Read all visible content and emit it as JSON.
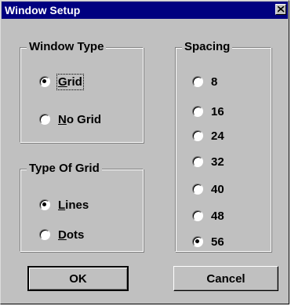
{
  "window": {
    "title": "Window Setup",
    "close_icon": "close-icon"
  },
  "window_type": {
    "label": "Window Type",
    "options": [
      {
        "label": "Grid",
        "mnemonic": "G",
        "rest": "rid",
        "selected": true
      },
      {
        "label": "No Grid",
        "mnemonic": "N",
        "rest": "o Grid",
        "selected": false
      }
    ]
  },
  "grid_type": {
    "label": "Type Of Grid",
    "options": [
      {
        "label": "Lines",
        "mnemonic": "L",
        "rest": "ines",
        "selected": true
      },
      {
        "label": "Dots",
        "mnemonic": "D",
        "rest": "ots",
        "selected": false
      }
    ]
  },
  "spacing": {
    "label": "Spacing",
    "options": [
      {
        "label": "8",
        "selected": false
      },
      {
        "label": "16",
        "selected": false
      },
      {
        "label": "24",
        "selected": false
      },
      {
        "label": "32",
        "selected": false
      },
      {
        "label": "40",
        "selected": false
      },
      {
        "label": "48",
        "selected": false
      },
      {
        "label": "56",
        "selected": true
      }
    ]
  },
  "buttons": {
    "ok": "OK",
    "cancel": "Cancel"
  }
}
